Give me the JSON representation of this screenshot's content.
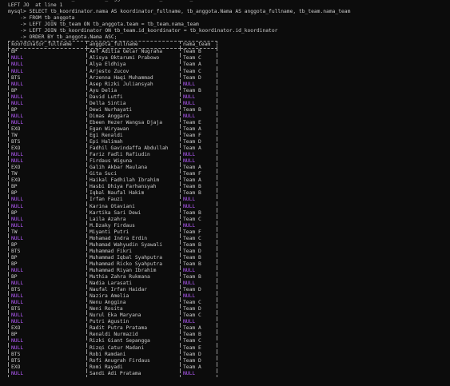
{
  "pre_lines": [
    "      -> LEFT JOIN tb_team ON tb_anggota.team = tb_team.nama_team",
    "LEFT JO  at line 1",
    "mysql> SELECT tb_koordinator.nama AS koordinator_fullname, tb_anggota.Nama AS anggota_fullname, tb_team.nama_team",
    "    -> FROM tb_anggota",
    "    -> LEFT JOIN tb_team ON tb_anggota.team = tb_team.nama_team",
    "    -> LEFT JOIN tb_koordinator ON tb_team.id_koordinator = tb_koordinator.id_koordinator",
    "    -> ORDER BY tb_anggota.Nama ASC;"
  ],
  "columns": [
    "koordinator_fullname",
    "anggota_fullname",
    "nama_team"
  ],
  "rows": [
    [
      "BP",
      "Aef Aditia Gelar Nugraha",
      "Team B"
    ],
    [
      "NULL",
      "Alisya Oktarumi Prabowo",
      "Team C"
    ],
    [
      "NULL",
      "Alya Eldhiya",
      "Team A"
    ],
    [
      "NULL",
      "Arjesto Zucov",
      "Team C"
    ],
    [
      "BTS",
      "Arzenna Haqi Muhammad",
      "Team D"
    ],
    [
      "NULL",
      "Asep Rizki Juliansyah",
      "NULL"
    ],
    [
      "BP",
      "Ayu Delia",
      "Team B"
    ],
    [
      "NULL",
      "David Lutfi",
      "NULL"
    ],
    [
      "NULL",
      "Della Sintia",
      "NULL"
    ],
    [
      "BP",
      "Dewi Nurhayati",
      "Team B"
    ],
    [
      "NULL",
      "Dimas Anggara",
      "NULL"
    ],
    [
      "NULL",
      "Ebeen Hezer Wangsa Djaja",
      "Team E"
    ],
    [
      "EXO",
      "Egan Wiryawan",
      "Team A"
    ],
    [
      "TW",
      "Egi Renaldi",
      "Team F"
    ],
    [
      "BTS",
      "Epi Halimah",
      "Team D"
    ],
    [
      "EXO",
      "Fadhil Gavindaffa Abdullah",
      "Team A"
    ],
    [
      "NULL",
      "Fariz Fadli Rafiudin",
      "NULL"
    ],
    [
      "NULL",
      "Firdaus Wiguna",
      "NULL"
    ],
    [
      "EXO",
      "Galih Akbar Maulana",
      "Team A"
    ],
    [
      "TW",
      "Gita Suci",
      "Team F"
    ],
    [
      "EXO",
      "Haikal Fadhilah Ibrahim",
      "Team A"
    ],
    [
      "BP",
      "Hasbi Dhiya Farhansyah",
      "Team B"
    ],
    [
      "BP",
      "Iqbal Naufal Hakim",
      "Team B"
    ],
    [
      "NULL",
      "Irfan Fauzi",
      "NULL"
    ],
    [
      "NULL",
      "Karina Otaviani",
      "NULL"
    ],
    [
      "BP",
      "Kartika Sari Dewi",
      "Team B"
    ],
    [
      "NULL",
      "Laila Azahra",
      "Team C"
    ],
    [
      "NULL",
      "M.Dzaky Firdaus",
      "NULL"
    ],
    [
      "TW",
      "Miyanti Putri",
      "Team F"
    ],
    [
      "NULL",
      "Mohamad Indra Erdin",
      "Team C"
    ],
    [
      "BP",
      "Muhamad Wahyudin Syawali",
      "Team B"
    ],
    [
      "BTS",
      "Muhammad Fikri",
      "Team D"
    ],
    [
      "BP",
      "Muhammad Iqbal Syahputra",
      "Team B"
    ],
    [
      "BP",
      "Muhammad Ricko Syahputra",
      "Team B"
    ],
    [
      "NULL",
      "Muhammad Riyan Ibrahim",
      "NULL"
    ],
    [
      "BP",
      "Muthia Zahra Rukmana",
      "Team B"
    ],
    [
      "NULL",
      "Nadia Larasati",
      "NULL"
    ],
    [
      "BTS",
      "Naufal Irfan Haidar",
      "Team D"
    ],
    [
      "NULL",
      "Nazira Amelia",
      "NULL"
    ],
    [
      "NULL",
      "Nenu Anggina",
      "Team C"
    ],
    [
      "BTS",
      "Neni Rosita",
      "Team D"
    ],
    [
      "NULL",
      "Nurul Eka Maryana",
      "Team C"
    ],
    [
      "NULL",
      "Putri Agustin",
      "NULL"
    ],
    [
      "EXO",
      "Radit Putra Pratama",
      "Team A"
    ],
    [
      "BP",
      "Renaldi Nurmazid",
      "Team B"
    ],
    [
      "NULL",
      "Rizki Giant Sepangga",
      "Team C"
    ],
    [
      "NULL",
      "Rizqi Catur Madani",
      "Team E"
    ],
    [
      "BTS",
      "Robi Ramdani",
      "Team D"
    ],
    [
      "BTS",
      "Rofi Anugrah Firdaus",
      "Team D"
    ],
    [
      "EXO",
      "Romi Rayadi",
      "Team A"
    ],
    [
      "NULL",
      "Sandi Adi Pratama",
      "NULL"
    ]
  ]
}
